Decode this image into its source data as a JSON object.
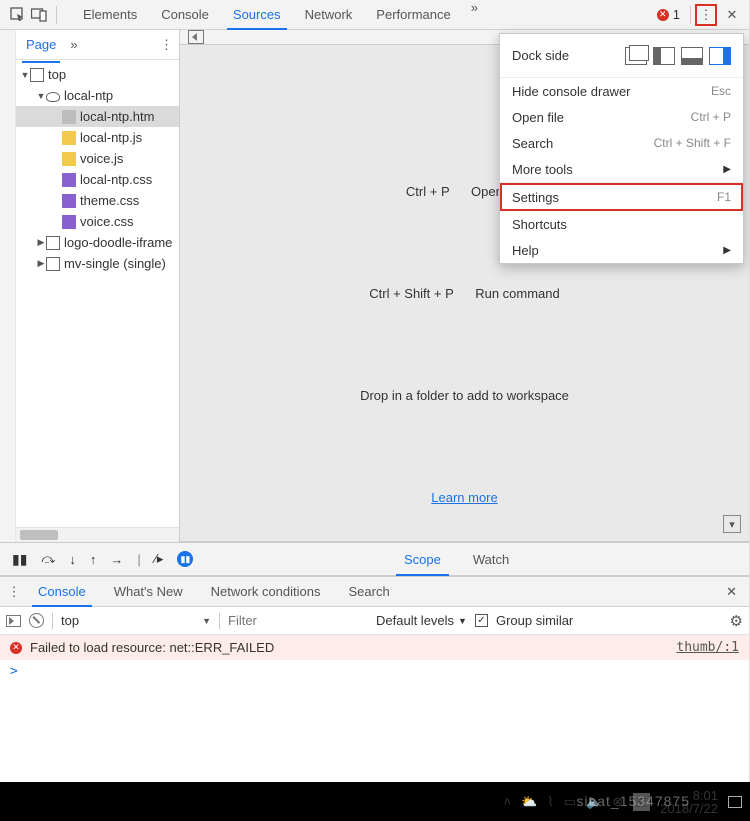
{
  "topbar": {
    "tabs": [
      "Elements",
      "Console",
      "Sources",
      "Network",
      "Performance"
    ],
    "active": 2,
    "more": "»",
    "error_count": "1"
  },
  "sidebar": {
    "page_label": "Page",
    "more": "»",
    "tree": [
      {
        "depth": 0,
        "expand": "▼",
        "icon": "frame",
        "label": "top"
      },
      {
        "depth": 1,
        "expand": "▼",
        "icon": "cloud",
        "label": "local-ntp"
      },
      {
        "depth": 2,
        "expand": "",
        "icon": "file",
        "label": "local-ntp.htm",
        "sel": true
      },
      {
        "depth": 2,
        "expand": "",
        "icon": "js",
        "label": "local-ntp.js"
      },
      {
        "depth": 2,
        "expand": "",
        "icon": "js",
        "label": "voice.js"
      },
      {
        "depth": 2,
        "expand": "",
        "icon": "css",
        "label": "local-ntp.css"
      },
      {
        "depth": 2,
        "expand": "",
        "icon": "css",
        "label": "theme.css"
      },
      {
        "depth": 2,
        "expand": "",
        "icon": "css",
        "label": "voice.css"
      },
      {
        "depth": 1,
        "expand": "▶",
        "icon": "frame",
        "label": "logo-doodle-iframe"
      },
      {
        "depth": 1,
        "expand": "▶",
        "icon": "frame",
        "label": "mv-single (single)"
      }
    ]
  },
  "main": {
    "hint_line1a": "Ctrl + P",
    "hint_line1b": "Open file",
    "hint_line2a": "Ctrl + Shift + P",
    "hint_line2b": "Run command",
    "hint_line3": "Drop in a folder to add to workspace",
    "learn_more": "Learn more"
  },
  "dbg": {
    "tabs": [
      "Scope",
      "Watch"
    ],
    "active": 0
  },
  "drawer": {
    "tabs": [
      "Console",
      "What's New",
      "Network conditions",
      "Search"
    ],
    "active": 0,
    "ctx_label": "top",
    "filter_ph": "Filter",
    "levels": "Default levels",
    "group": "Group similar",
    "error_msg": "Failed to load resource: net::ERR_FAILED",
    "error_loc": "thumb/:1",
    "prompt": ">"
  },
  "popup": {
    "dock": "Dock side",
    "items": [
      {
        "label": "Hide console drawer",
        "sc": "Esc"
      },
      {
        "label": "Open file",
        "sc": "Ctrl + P"
      },
      {
        "label": "Search",
        "sc": "Ctrl + Shift + F"
      },
      {
        "label": "More tools",
        "sc": "",
        "arrow": true
      }
    ],
    "settings": {
      "label": "Settings",
      "sc": "F1"
    },
    "tail": [
      {
        "label": "Shortcuts",
        "sc": ""
      },
      {
        "label": "Help",
        "sc": "",
        "arrow": true
      }
    ]
  },
  "taskbar": {
    "ime": "五",
    "time": "8:01",
    "date": "2018/7/22"
  },
  "watermark": "sinat_15347875"
}
